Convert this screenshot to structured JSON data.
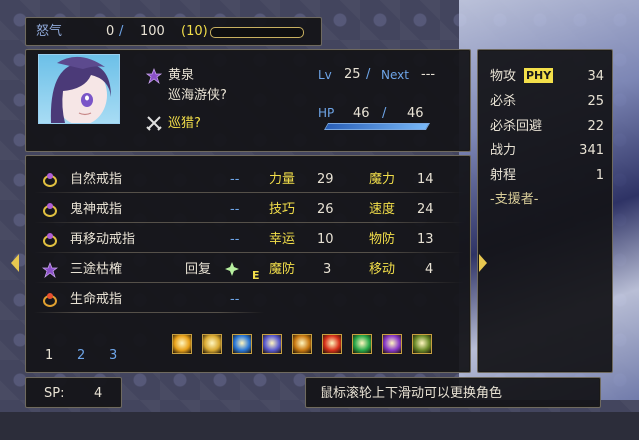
{
  "rage": {
    "label": "怒气",
    "current": "0",
    "sep": "/",
    "max": "100",
    "bonus": "(10)",
    "fill": 0
  },
  "character": {
    "name": "黄泉",
    "class_name": "巡海游侠?",
    "sub_class": "巡猎?",
    "lv_label": "Lv",
    "lv": "25",
    "sep": "/",
    "next_label": "Next",
    "next_value": "---",
    "hp_label": "HP",
    "hp_current": "46",
    "hp_max": "46",
    "hp_fill": 1.0
  },
  "combat": {
    "rows": [
      {
        "label": "物攻",
        "tag": "PHY",
        "value": "34"
      },
      {
        "label": "必杀",
        "value": "25"
      },
      {
        "label": "必杀回避",
        "value": "22"
      },
      {
        "label": "战力",
        "value": "341"
      },
      {
        "label": "射程",
        "value": "1"
      }
    ],
    "supporter": "-支援者-"
  },
  "items": [
    {
      "name": "自然戒指",
      "value": "--",
      "icon": "ring-icon"
    },
    {
      "name": "鬼神戒指",
      "value": "--",
      "icon": "ring-icon"
    },
    {
      "name": "再移动戒指",
      "value": "--",
      "icon": "ring-icon"
    },
    {
      "name": "三途枯榷",
      "value": "回复",
      "icon": "weapon-icon",
      "equip": "E"
    },
    {
      "name": "生命戒指",
      "value": "--",
      "icon": "ring-icon"
    }
  ],
  "stats": [
    {
      "l1": "力量",
      "v1": "29",
      "l2": "魔力",
      "v2": "14"
    },
    {
      "l1": "技巧",
      "v1": "26",
      "l2": "速度",
      "v2": "24"
    },
    {
      "l1": "幸运",
      "v1": "10",
      "l2": "物防",
      "v2": "13"
    },
    {
      "l1": "魔防",
      "v1": "3",
      "l2": "移动",
      "v2": "4"
    }
  ],
  "pages": [
    "1",
    "2",
    "3"
  ],
  "skills": [
    {
      "icon": "arrow-up-icon",
      "color": "#e8a018"
    },
    {
      "icon": "sparkle-burst-icon",
      "color": "#d8a830"
    },
    {
      "icon": "blue-swirl-icon",
      "color": "#2a78d8"
    },
    {
      "icon": "crescent-moon-icon",
      "color": "#5a5ad0"
    },
    {
      "icon": "gold-crescent-icon",
      "color": "#c87810"
    },
    {
      "icon": "flame-icon",
      "color": "#d83018"
    },
    {
      "icon": "green-star-icon",
      "color": "#28a848"
    },
    {
      "icon": "purple-star-icon",
      "color": "#8838c8"
    },
    {
      "icon": "bar-chart-icon",
      "color": "#6a8a28"
    }
  ],
  "sp": {
    "label": "SP:",
    "value": "4"
  },
  "hint": "鼠标滚轮上下滑动可以更换角色"
}
